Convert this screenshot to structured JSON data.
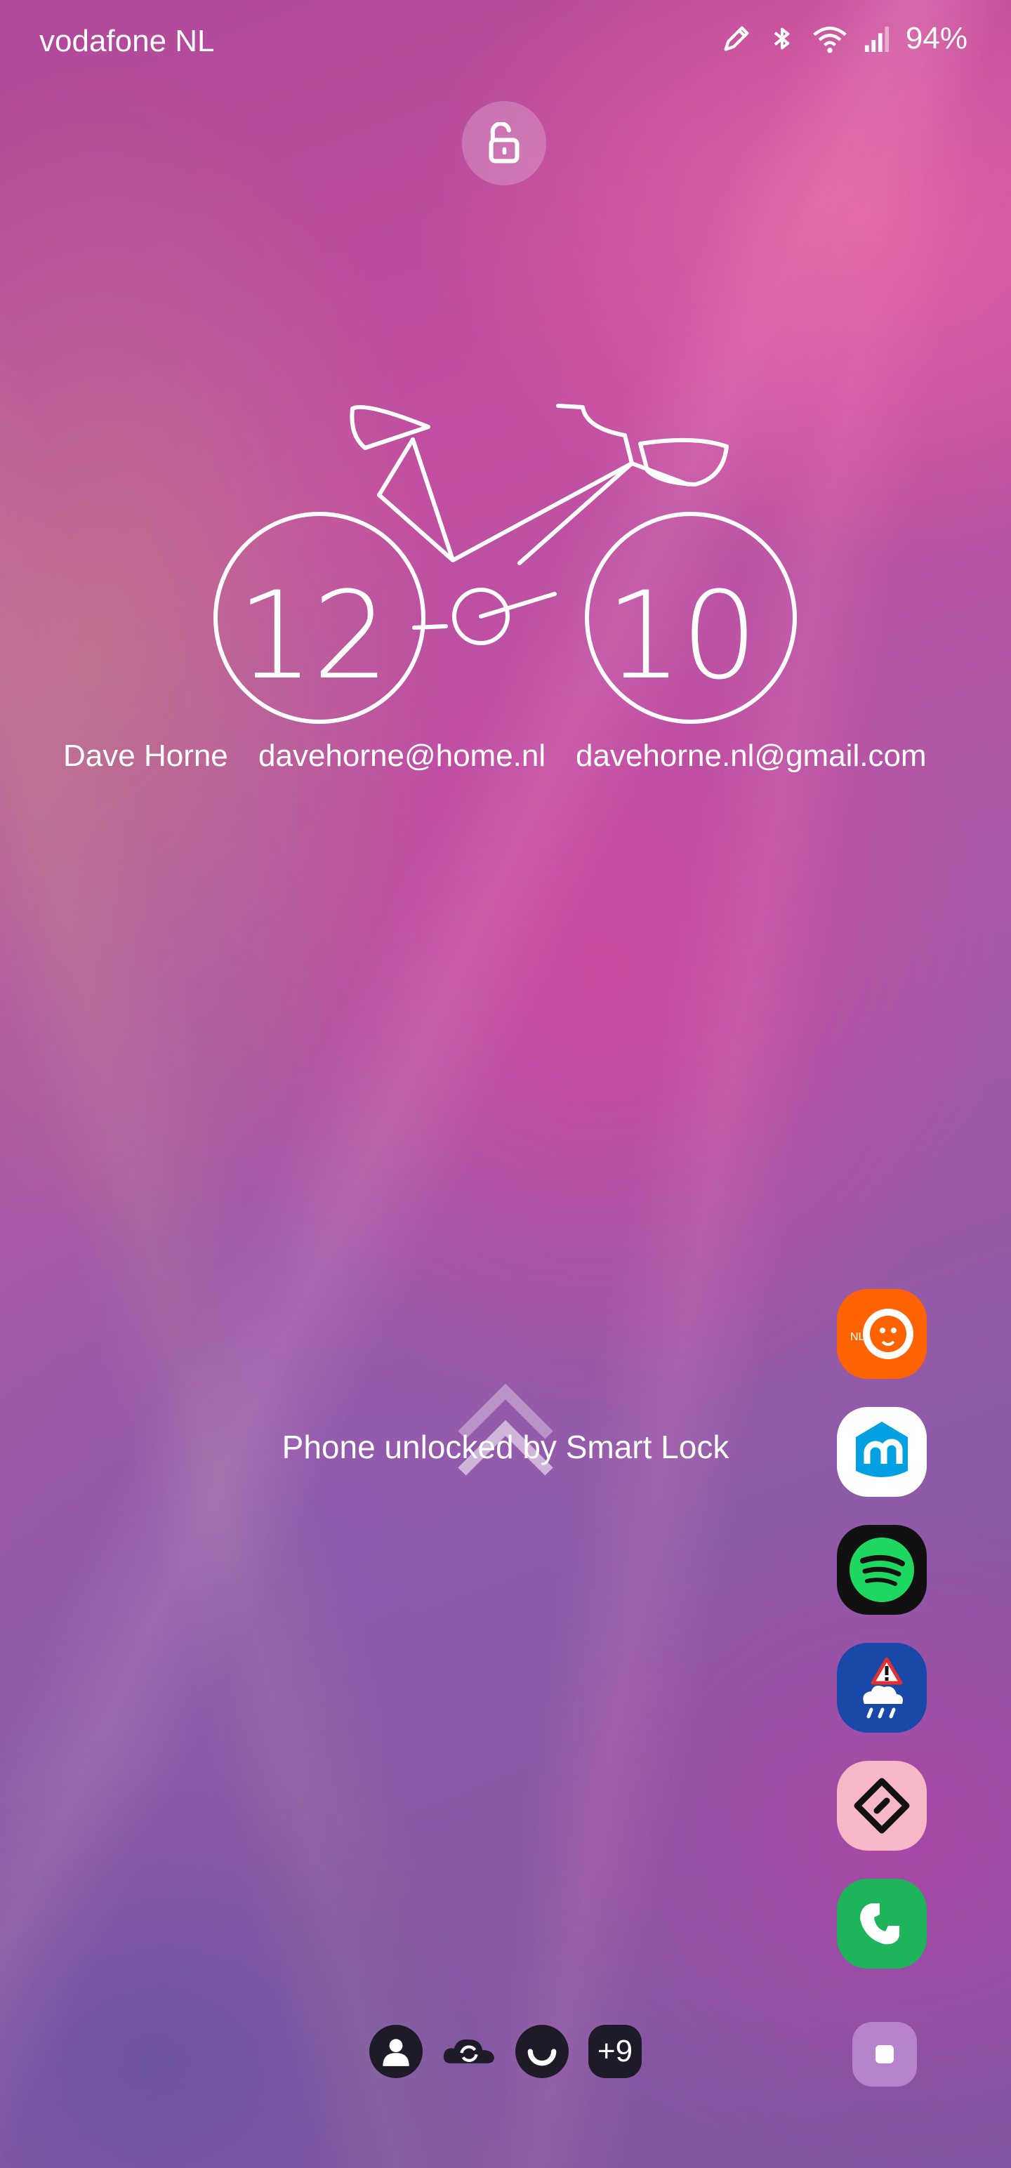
{
  "status_bar": {
    "carrier": "vodafone NL",
    "battery": "94%",
    "icons": [
      "edit-pen-icon",
      "bluetooth-icon",
      "wifi-icon",
      "cell-signal-icon"
    ]
  },
  "lock": {
    "icon": "unlocked-padlock-icon"
  },
  "clock": {
    "hour": "12",
    "minute": "10",
    "style": "bicycle-wheels"
  },
  "owner": {
    "name": "Dave Horne",
    "email_1": "davehorne@home.nl",
    "email_2": "davehorne.nl@gmail.com"
  },
  "smart_lock": {
    "message": "Phone unlocked by Smart Lock"
  },
  "app_shortcuts": [
    {
      "icon": "ing-lion-icon",
      "color": "#ff6200"
    },
    {
      "icon": "albert-heijn-icon",
      "color": "#00a0e2"
    },
    {
      "icon": "spotify-icon",
      "color": "#1ed760"
    },
    {
      "icon": "weather-alert-icon",
      "color": "#1948a8"
    },
    {
      "icon": "ticket-icon",
      "color": "#f6b8c6"
    },
    {
      "icon": "phone-icon",
      "color": "#1db45b"
    }
  ],
  "notifications": {
    "more_count": "+9"
  }
}
